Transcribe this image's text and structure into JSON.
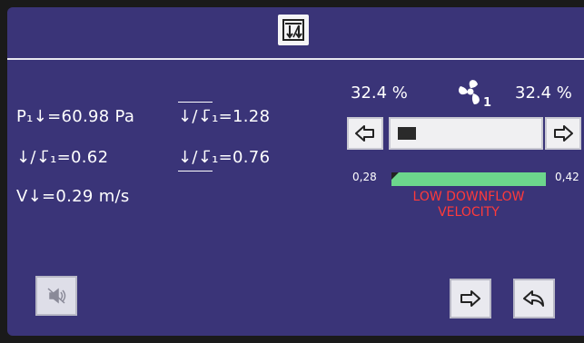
{
  "header": {
    "icon": "filter-flow-icon"
  },
  "readings": {
    "p1_label": "P₁",
    "p1_value": "=60.98 Pa",
    "ratio1_value": "=0.62",
    "velocity_label": "V",
    "velocity_value": "=0.29 m/s",
    "ratio2_value": "=1.28",
    "ratio3_value": "=0.76"
  },
  "fan": {
    "icon": "fan-icon",
    "left_percent": "32.4 %",
    "right_percent": "32.4 %",
    "speed_level": 0.13
  },
  "velocity": {
    "min_label": "0,28",
    "max_label": "0,42",
    "bar_color": "#6cd68c",
    "status_line1": "LOW DOWNFLOW",
    "status_line2": "VELOCITY",
    "status_color": "#ff3a3a"
  },
  "buttons": {
    "mute": "alarm-mute-icon",
    "next": "arrow-right-icon",
    "back": "back-arrow-icon",
    "decrease": "arrow-left-icon",
    "increase": "arrow-right-icon"
  }
}
